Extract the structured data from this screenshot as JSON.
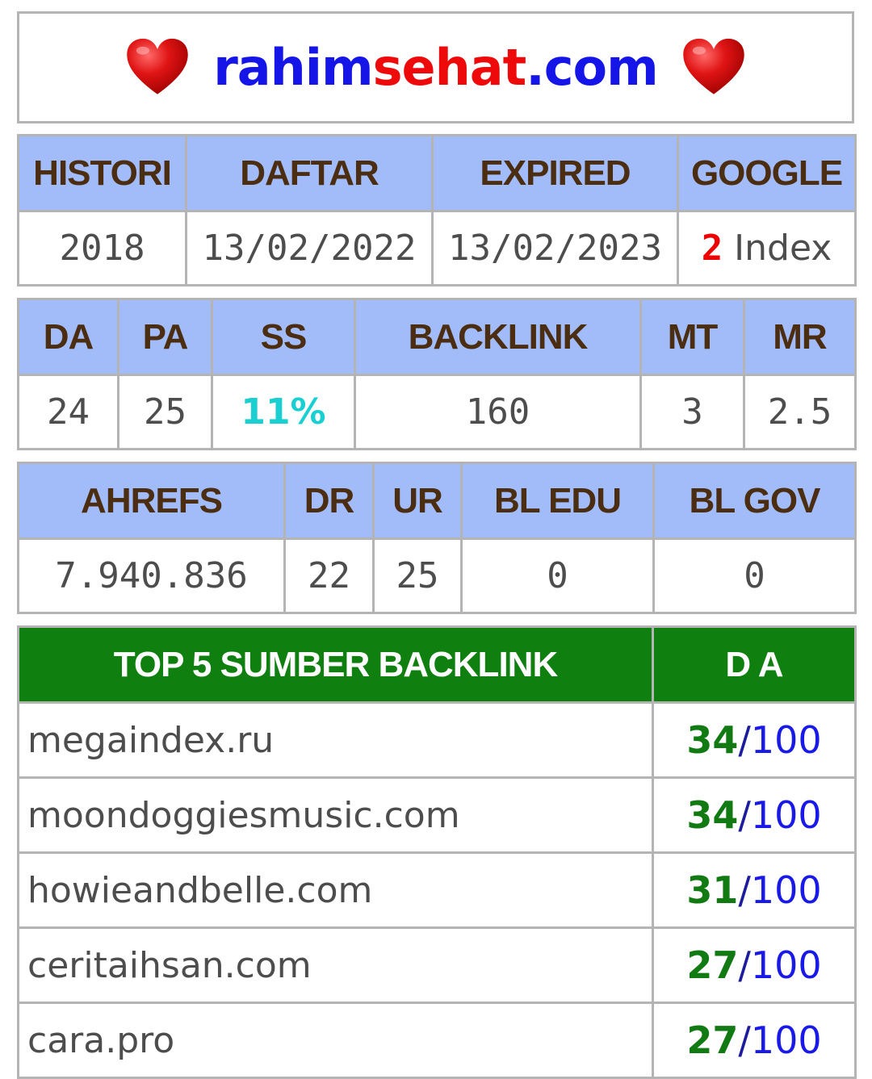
{
  "header": {
    "title_part1": "rahim",
    "title_part2": "sehat",
    "title_part3": ".com",
    "colors": {
      "blue": "#1515e8",
      "red": "#ee0a0a"
    },
    "heart_icon": "red-heart-icon"
  },
  "table1": {
    "headers": [
      "HISTORI",
      "DAFTAR",
      "EXPIRED",
      "GOOGLE"
    ],
    "values": {
      "histori": "2018",
      "daftar": "13/02/2022",
      "expired": "13/02/2023",
      "google_count": "2",
      "google_label": " Index"
    }
  },
  "table2": {
    "headers": [
      "DA",
      "PA",
      "SS",
      "BACKLINK",
      "MT",
      "MR"
    ],
    "values": [
      "24",
      "25",
      "11%",
      "160",
      "3",
      "2.5"
    ]
  },
  "table3": {
    "headers": [
      "AHREFS",
      "DR",
      "UR",
      "BL EDU",
      "BL GOV"
    ],
    "values": [
      "7.940.836",
      "22",
      "25",
      "0",
      "0"
    ]
  },
  "table4": {
    "headers": [
      "TOP 5 SUMBER BACKLINK",
      "D A"
    ],
    "rows": [
      {
        "source": "megaindex.ru",
        "da": "34",
        "slash": "/",
        "max": "100"
      },
      {
        "source": "moondoggiesmusic.com",
        "da": "34",
        "slash": "/",
        "max": "100"
      },
      {
        "source": "howieandbelle.com",
        "da": "31",
        "slash": "/",
        "max": "100"
      },
      {
        "source": "ceritaihsan.com",
        "da": "27",
        "slash": "/",
        "max": "100"
      },
      {
        "source": "cara.pro",
        "da": "27",
        "slash": "/",
        "max": "100"
      }
    ]
  },
  "colors": {
    "header_bg": "#a2bcf9",
    "header_text": "#4b2d12",
    "green_header_bg": "#0f7f0f",
    "border": "#b4b4b4"
  }
}
